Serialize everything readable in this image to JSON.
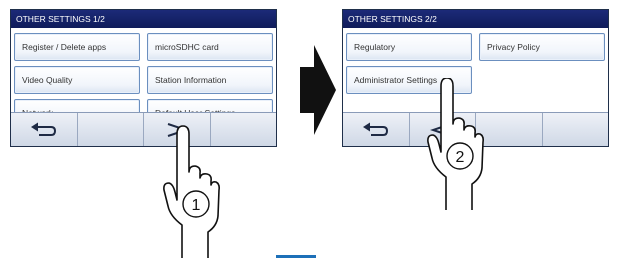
{
  "screens": [
    {
      "title": "OTHER SETTINGS 1/2",
      "buttons": [
        "Register / Delete apps",
        "microSDHC card",
        "Video Quality",
        "Station Information",
        "Network",
        "Default User Settings"
      ]
    },
    {
      "title": "OTHER SETTINGS 2/2",
      "buttons": [
        "Regulatory",
        "Privacy Policy",
        "Administrator Settings"
      ]
    }
  ],
  "steps": [
    "1",
    "2"
  ],
  "icons": {
    "back": "return-arrow-icon",
    "next": "next-chevron-icon",
    "prev": "prev-chevron-icon",
    "flow": "flow-arrow-icon",
    "hand": "pointing-hand-icon"
  },
  "colors": {
    "titlebar": "#162570",
    "button_border": "#6b8fbf",
    "accent": "#1d70b8"
  }
}
